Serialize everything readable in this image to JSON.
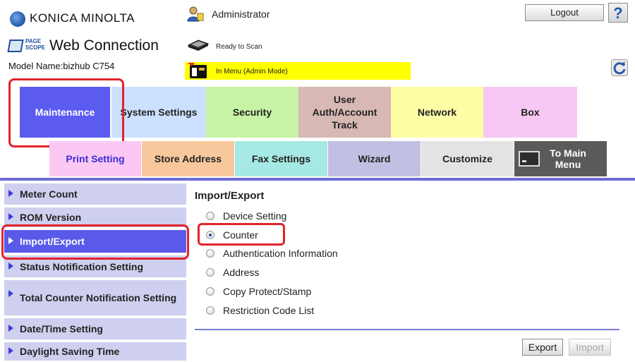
{
  "header": {
    "brand": "KONICA MINOLTA",
    "pagescope": "PAGE SCOPE",
    "product": "Web Connection",
    "model": "Model Name:bizhub C754",
    "user": "Administrator",
    "status": "Ready to Scan",
    "mode": "In Menu (Admin Mode)",
    "logout_label": "Logout",
    "help_label": "?"
  },
  "tabs_top": [
    {
      "label": "Maintenance",
      "color": "#5b5bf0",
      "active": true
    },
    {
      "label": "System Settings",
      "color": "#cce0ff"
    },
    {
      "label": "Security",
      "color": "#c6f3a4"
    },
    {
      "label": "User Auth/Account Track",
      "color": "#d7b8b4"
    },
    {
      "label": "Network",
      "color": "#fdfda6"
    },
    {
      "label": "Box",
      "color": "#f7c8f3"
    }
  ],
  "tabs_second": [
    {
      "label": "Print Setting",
      "color": "#fbc8f3"
    },
    {
      "label": "Store Address",
      "color": "#f8c89c"
    },
    {
      "label": "Fax Settings",
      "color": "#a6e8e3"
    },
    {
      "label": "Wizard",
      "color": "#c1c0e2"
    },
    {
      "label": "Customize",
      "color": "#e3e3e3"
    },
    {
      "label": "To Main Menu",
      "color": "#5a5a5a"
    }
  ],
  "sidebar": {
    "items": [
      {
        "label": "Meter Count"
      },
      {
        "label": "ROM Version"
      },
      {
        "label": "Import/Export",
        "active": true
      },
      {
        "label": "Status Notification Setting"
      },
      {
        "label": "Total Counter Notification Setting"
      },
      {
        "label": "Date/Time Setting"
      },
      {
        "label": "Daylight Saving Time"
      }
    ]
  },
  "main": {
    "title": "Import/Export",
    "options": [
      {
        "label": "Device Setting",
        "checked": false
      },
      {
        "label": "Counter",
        "checked": true
      },
      {
        "label": "Authentication Information",
        "checked": false
      },
      {
        "label": "Address",
        "checked": false
      },
      {
        "label": "Copy Protect/Stamp",
        "checked": false
      },
      {
        "label": "Restriction Code List",
        "checked": false
      }
    ],
    "export_label": "Export",
    "import_label": "Import"
  },
  "colors": {
    "accent": "#5959ea",
    "highlight_red": "#e0242c",
    "mode_bar": "#ffff00"
  },
  "icons": [
    "globe-logo-icon",
    "pagescope-icon",
    "admin-user-icon",
    "scanner-icon",
    "admin-mode-icon",
    "refresh-icon",
    "menu-icon"
  ]
}
